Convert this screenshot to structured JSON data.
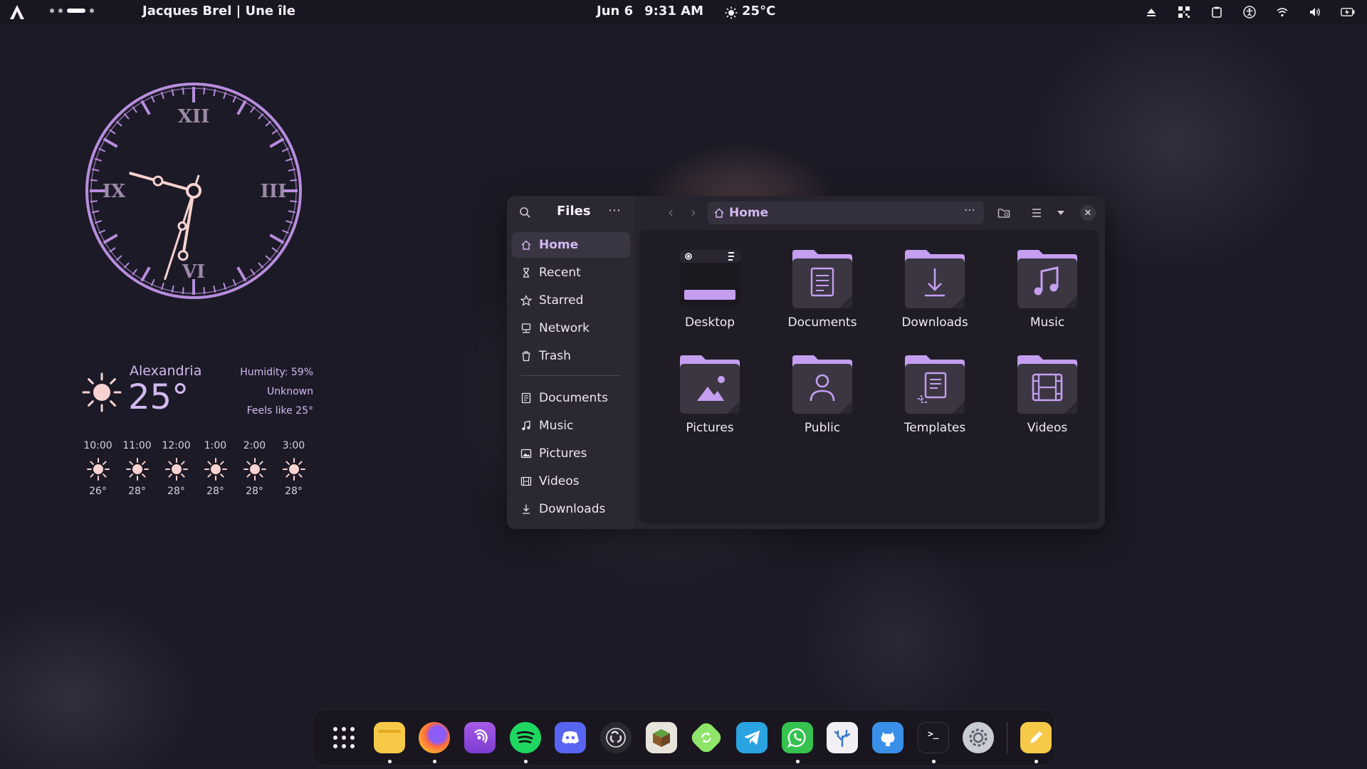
{
  "topbar": {
    "media": "Jacques Brel | Une île",
    "date": "Jun 6",
    "time": "9:31 AM",
    "weather_icon": "sun-icon",
    "temp": "25°C",
    "tray_icons": [
      "eject-icon",
      "qr-icon",
      "clipboard-icon",
      "accessibility-icon",
      "wifi-icon",
      "volume-icon",
      "battery-icon"
    ]
  },
  "clock": {
    "numerals": [
      "XII",
      "III",
      "VI",
      "IX"
    ],
    "hour": 9,
    "minute": 31,
    "second": 33
  },
  "weather": {
    "city": "Alexandria",
    "temp": "25°",
    "humidity": "Humidity: 59%",
    "condition": "Unknown",
    "feels_like": "Feels like 25°",
    "hourly": [
      {
        "time": "10:00",
        "temp": "26°"
      },
      {
        "time": "11:00",
        "temp": "28°"
      },
      {
        "time": "12:00",
        "temp": "28°"
      },
      {
        "time": "1:00",
        "temp": "28°"
      },
      {
        "time": "2:00",
        "temp": "28°"
      },
      {
        "time": "3:00",
        "temp": "28°"
      }
    ]
  },
  "files": {
    "title": "Files",
    "path": "Home",
    "sidebar": [
      {
        "label": "Home",
        "icon": "home-icon"
      },
      {
        "label": "Recent",
        "icon": "recent-icon"
      },
      {
        "label": "Starred",
        "icon": "star-icon"
      },
      {
        "label": "Network",
        "icon": "network-icon"
      },
      {
        "label": "Trash",
        "icon": "trash-icon"
      },
      {
        "label": "Documents",
        "icon": "documents-icon"
      },
      {
        "label": "Music",
        "icon": "music-icon"
      },
      {
        "label": "Pictures",
        "icon": "pictures-icon"
      },
      {
        "label": "Videos",
        "icon": "videos-icon"
      },
      {
        "label": "Downloads",
        "icon": "downloads-icon"
      }
    ],
    "items": [
      {
        "label": "Desktop"
      },
      {
        "label": "Documents"
      },
      {
        "label": "Downloads"
      },
      {
        "label": "Music"
      },
      {
        "label": "Pictures"
      },
      {
        "label": "Public"
      },
      {
        "label": "Templates"
      },
      {
        "label": "Videos"
      }
    ]
  },
  "dock": {
    "apps": [
      "app-grid",
      "files",
      "firefox",
      "podcasts",
      "spotify",
      "discord",
      "obs",
      "minecraft",
      "refresh",
      "telegram",
      "whatsapp",
      "coral",
      "github",
      "terminal",
      "settings",
      "notes"
    ]
  },
  "colors": {
    "accent": "#d3b8f0",
    "clock_hands": "#f6d2d0",
    "clock_ring": "#b78ddd"
  }
}
